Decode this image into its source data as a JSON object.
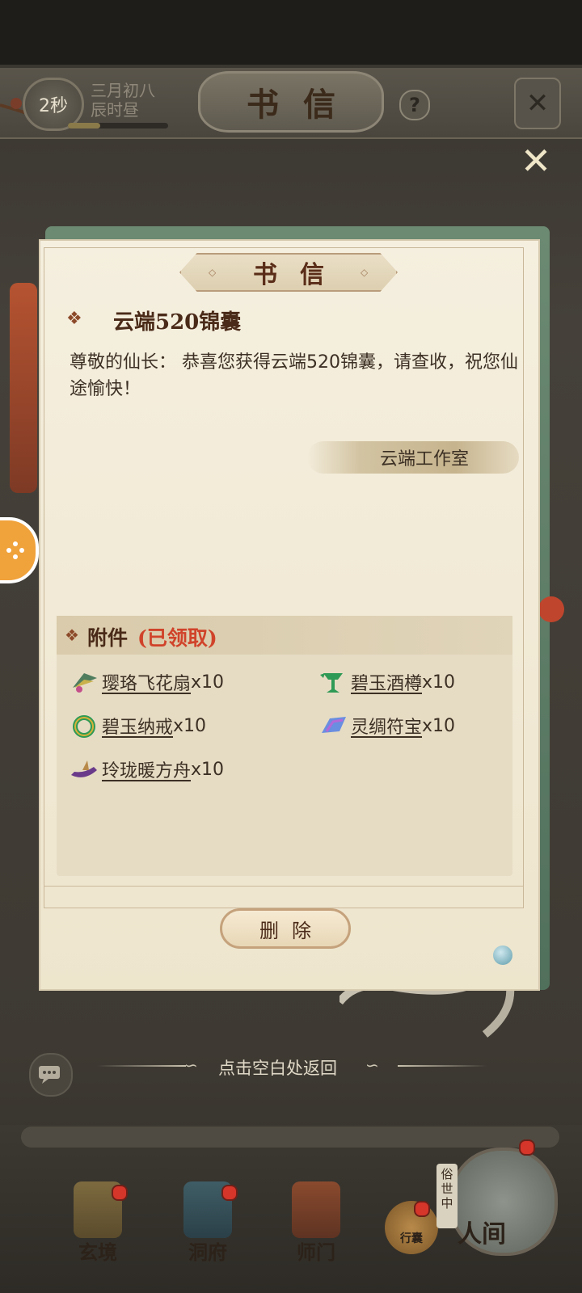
{
  "header": {
    "timer": "2秒",
    "date_line1": "三月初八",
    "date_line2": "辰时昼",
    "title": "书信",
    "help_icon": "question-mark-icon",
    "close_icon": "close-icon"
  },
  "letter": {
    "title": "书信",
    "subject_icon": "diamond-icon",
    "subject": "云端520锦囊",
    "body": "尊敬的仙长： 恭喜您获得云端520锦囊，请查收，祝您仙途愉快！",
    "sender": "云端工作室",
    "attachments": {
      "label": "附件",
      "status": "(已领取)",
      "items": [
        {
          "name": "璎珞飞花扇",
          "qty": "x10"
        },
        {
          "name": "碧玉酒樽",
          "qty": "x10"
        },
        {
          "name": "碧玉纳戒",
          "qty": "x10"
        },
        {
          "name": "灵绸符宝",
          "qty": "x10"
        },
        {
          "name": "玲珑暖方舟",
          "qty": "x10"
        }
      ]
    },
    "delete_label": "删除"
  },
  "hint": "点击空白处返回",
  "nav": {
    "items": [
      {
        "label": "玄境"
      },
      {
        "label": "洞府"
      },
      {
        "label": "师门"
      }
    ],
    "bag_label": "行囊",
    "world_tag": "俗世中",
    "world_label": "人间"
  },
  "colors": {
    "paper": "#f3ecda",
    "accent_red": "#d0432a",
    "text_brown": "#4a2a18"
  }
}
